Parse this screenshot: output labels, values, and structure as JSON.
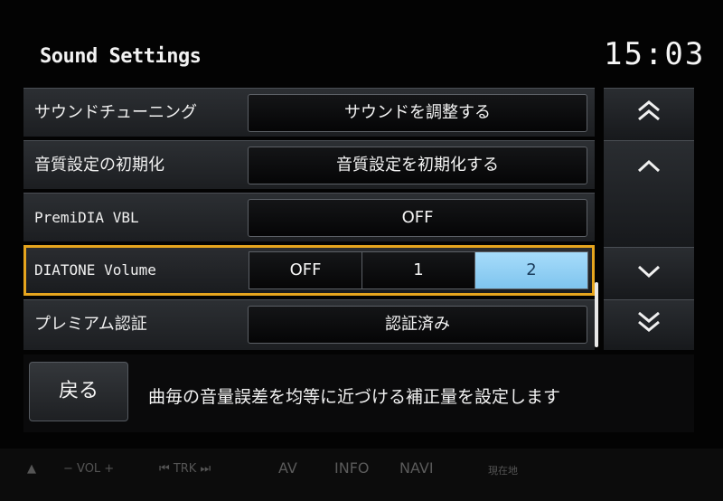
{
  "header": {
    "title": "Sound Settings",
    "clock": "15:03"
  },
  "rows": [
    {
      "label": "サウンドチューニング",
      "value": "サウンドを調整する"
    },
    {
      "label": "音質設定の初期化",
      "value": "音質設定を初期化する"
    },
    {
      "label": "PremiDIA VBL",
      "value": "OFF"
    },
    {
      "label": "DIATONE Volume",
      "options": [
        "OFF",
        "1",
        "2"
      ],
      "selected": "2"
    },
    {
      "label": "プレミアム認証",
      "value": "認証済み"
    }
  ],
  "nav": {
    "page_up_icon": "double-chevron-up",
    "up_icon": "chevron-up",
    "down_icon": "chevron-down",
    "page_down_icon": "double-chevron-down",
    "page_up_glyph": "⌃⌃",
    "up_glyph": "⌃",
    "down_glyph": "⌄",
    "page_down_glyph": "⌄⌄"
  },
  "footer": {
    "back_label": "戻る",
    "description": "曲毎の音量誤差を均等に近づける補正量を設定します"
  },
  "bezel": {
    "eject": "▲",
    "vol": "−  VOL  +",
    "trk": "⏮  TRK  ⏭",
    "av": "AV",
    "info": "INFO",
    "navi": "NAVI",
    "current": "現在地"
  },
  "colors": {
    "accent_selected_border": "#e6a51e",
    "active_option": "#8fd0f5"
  }
}
